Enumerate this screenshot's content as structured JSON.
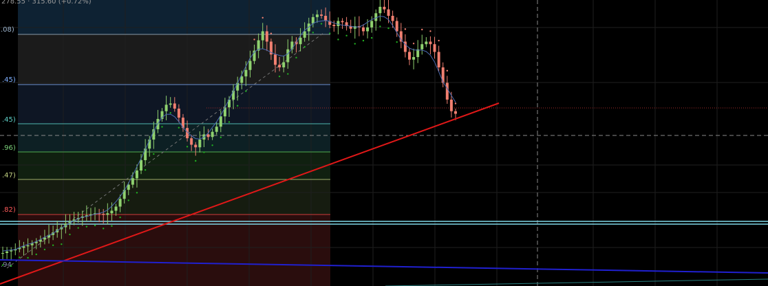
{
  "header": {
    "text": "278.55 · 315.60 (+0.72%)"
  },
  "chart_data": {
    "type": "candlestick",
    "fib_labels": [
      ".08)",
      ".45)",
      ".45)",
      ".96)",
      ".47)",
      ".82)"
    ],
    "fib_label_colors": [
      "#9fb7d0",
      "#7fb0ff",
      "#5fd0c8",
      "#7ad07a",
      "#c0d080",
      "#ff5a5a"
    ],
    "bottom_label": ".94",
    "colors": {
      "up_candle": "#8fd16f",
      "down_candle": "#f07f70",
      "trendline": "#e01818",
      "long_trendline": "#2020d0",
      "support_line": "#7fd8e8",
      "psar_dots": "#21b021",
      "dashed_cursor": "#9a9a9a",
      "last_price_line": "#c03030"
    },
    "x_range": [
      0,
      150
    ],
    "y_range": [
      0,
      100
    ],
    "series": [
      {
        "name": "",
        "values": [
          4.0,
          4.6,
          5.0,
          5.5,
          6.0,
          6.6,
          7.0,
          7.8,
          8.4,
          9.2,
          10.0,
          11.0,
          12.0,
          13.2,
          14.0,
          15.4,
          16.2,
          17.0,
          17.6,
          18.2,
          18.6,
          19.0,
          19.4,
          19.2,
          18.8,
          19.4,
          20.4,
          22.0,
          25.0,
          28.5,
          30.5,
          33.0,
          36.0,
          40.0,
          44.5,
          48.0,
          52.0,
          56.0,
          59.0,
          61.5,
          62.0,
          60.0,
          56.5,
          52.5,
          48.5,
          46.0,
          45.0,
          48.0,
          50.0,
          49.0,
          51.0,
          53.0,
          57.0,
          60.5,
          63.5,
          67.0,
          70.0,
          72.5,
          75.0,
          78.5,
          82.5,
          86.5,
          90.0,
          86.0,
          81.0,
          77.0,
          76.0,
          78.0,
          83.0,
          86.0,
          85.0,
          87.5,
          90.0,
          93.0,
          95.5,
          96.5,
          96.0,
          94.0,
          92.5,
          92.0,
          94.0,
          93.5,
          92.0,
          91.0,
          92.0,
          91.5,
          90.0,
          91.5,
          94.0,
          97.0,
          99.5,
          98.5,
          96.0,
          94.0,
          90.0,
          86.0,
          82.0,
          79.0,
          80.0,
          83.0,
          85.0,
          86.0,
          85.0,
          82.0,
          76.0,
          70.0,
          63.5,
          59.0,
          58.0
        ]
      }
    ]
  }
}
